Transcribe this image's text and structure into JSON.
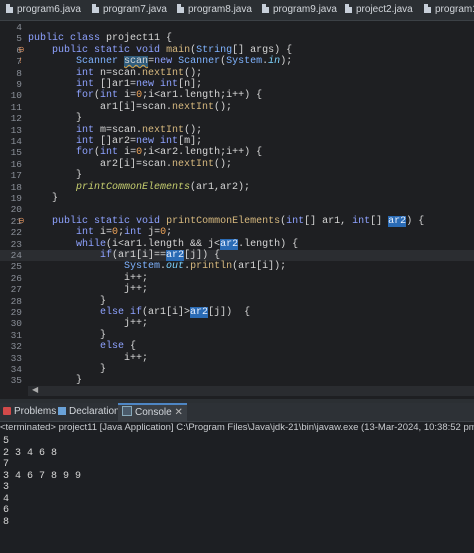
{
  "tabs": [
    "program6.java",
    "program7.java",
    "program8.java",
    "program9.java",
    "project2.java",
    "program1"
  ],
  "editor": {
    "lines": [
      {
        "n": "4",
        "mark": "",
        "html": ""
      },
      {
        "n": "5",
        "mark": "",
        "html": "<span class='kw'>public class</span> project11 {"
      },
      {
        "n": "6",
        "mark": "⊖",
        "html": "    <span class='kw'>public static void</span> <span class='meth'>main</span>(<span class='ty'>String</span>[] args) {"
      },
      {
        "n": "7",
        "mark": "!",
        "html": "        <span class='ty'>Scanner</span> <span class='warn'>scan</span>=<span class='kw'>new</span> <span class='ty'>Scanner</span>(<span class='ty'>System</span>.<span class='fld'>in</span>);"
      },
      {
        "n": "8",
        "mark": "",
        "html": "        <span class='kw'>int</span> n=scan.<span class='meth'>nextInt</span>();"
      },
      {
        "n": "9",
        "mark": "",
        "html": "        <span class='kw'>int</span> []ar1=<span class='kw'>new int</span>[n];"
      },
      {
        "n": "10",
        "mark": "",
        "html": "        <span class='kw'>for</span>(<span class='kw'>int</span> i=<span class='num'>0</span>;i&lt;ar1.length;i++) {"
      },
      {
        "n": "11",
        "mark": "",
        "html": "            ar1[i]=scan.<span class='meth'>nextInt</span>();"
      },
      {
        "n": "12",
        "mark": "",
        "html": "        }"
      },
      {
        "n": "13",
        "mark": "",
        "html": "        <span class='kw'>int</span> m=scan.<span class='meth'>nextInt</span>();"
      },
      {
        "n": "14",
        "mark": "",
        "html": "        <span class='kw'>int</span> []ar2=<span class='kw'>new int</span>[m];"
      },
      {
        "n": "15",
        "mark": "",
        "html": "        <span class='kw'>for</span>(<span class='kw'>int</span> i=<span class='num'>0</span>;i&lt;ar2.length;i++) {"
      },
      {
        "n": "16",
        "mark": "",
        "html": "            ar2[i]=scan.<span class='meth'>nextInt</span>();"
      },
      {
        "n": "17",
        "mark": "",
        "html": "        }"
      },
      {
        "n": "18",
        "mark": "",
        "html": "        <span class='it'>printCommonElements</span>(ar1,ar2);"
      },
      {
        "n": "19",
        "mark": "",
        "html": "    }"
      },
      {
        "n": "20",
        "mark": "",
        "html": ""
      },
      {
        "n": "21",
        "mark": "⊖",
        "html": "    <span class='kw'>public static void</span> <span class='meth'>printCommonElements</span>(<span class='kw'>int</span>[] ar1, <span class='kw'>int</span>[] <span class='hl'>ar2</span>) {"
      },
      {
        "n": "22",
        "mark": "",
        "html": "        <span class='kw'>int</span> i=<span class='num'>0</span>;<span class='kw'>int</span> j=<span class='num'>0</span>;"
      },
      {
        "n": "23",
        "mark": "",
        "html": "        <span class='kw'>while</span>(i&lt;ar1.length &amp;&amp; j&lt;<span class='hl'>ar2</span>.length) {"
      },
      {
        "n": "24",
        "mark": "",
        "html": "            <span class='kw'>if</span>(ar1[i]==<span class='hl'>ar2</span>[j]) {"
      },
      {
        "n": "25",
        "mark": "",
        "html": "                <span class='ty'>System</span>.<span class='fld'>out</span>.<span class='meth'>println</span>(ar1[i]);"
      },
      {
        "n": "26",
        "mark": "",
        "html": "                i++;"
      },
      {
        "n": "27",
        "mark": "",
        "html": "                j++;"
      },
      {
        "n": "28",
        "mark": "",
        "html": "            }"
      },
      {
        "n": "29",
        "mark": "",
        "html": "            <span class='kw'>else if</span>(ar1[i]&gt;<span class='hl'>ar2</span>[j])  {"
      },
      {
        "n": "30",
        "mark": "",
        "html": "                j++;"
      },
      {
        "n": "31",
        "mark": "",
        "html": "            }"
      },
      {
        "n": "32",
        "mark": "",
        "html": "            <span class='kw'>else</span> {"
      },
      {
        "n": "33",
        "mark": "",
        "html": "                i++;"
      },
      {
        "n": "34",
        "mark": "",
        "html": "            }"
      },
      {
        "n": "35",
        "mark": "",
        "html": "        }"
      }
    ],
    "current_line": "24"
  },
  "views": {
    "problems": "Problems",
    "declaration": "Declaration",
    "console": "Console"
  },
  "console": {
    "terminated": "<terminated> project11 [Java Application] C:\\Program Files\\Java\\jdk-21\\bin\\javaw.exe  (13-Mar-2024, 10:38:52 pm – 10:39",
    "output": [
      "5",
      "2 3 4 6 8",
      "7",
      "3 4 6 7 8 9 9",
      "3",
      "4",
      "6",
      "8"
    ]
  }
}
